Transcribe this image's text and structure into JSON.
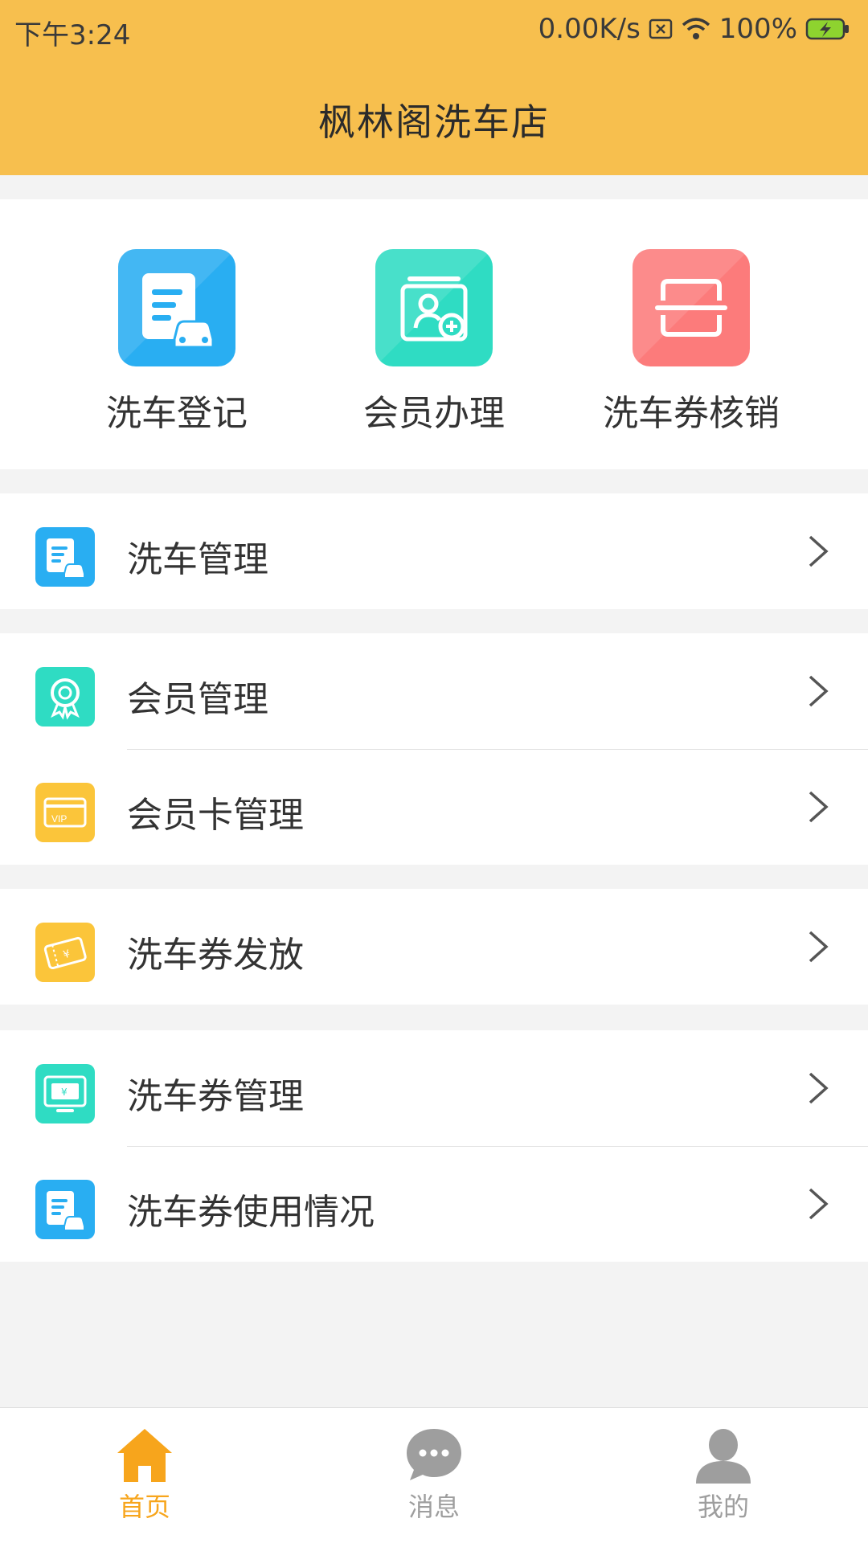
{
  "status_bar": {
    "time": "下午3:24",
    "network_speed": "0.00K/s",
    "battery": "100%",
    "icons": [
      "sim-off-icon",
      "wifi-icon",
      "battery-charging-icon"
    ]
  },
  "header": {
    "title": "枫林阁洗车店"
  },
  "quick_actions": [
    {
      "label": "洗车登记",
      "icon": "wash-register-icon",
      "color": "#29aef2"
    },
    {
      "label": "会员办理",
      "icon": "member-add-icon",
      "color": "#2fdcc3"
    },
    {
      "label": "洗车券核销",
      "icon": "scan-icon",
      "color": "#fc7b7b"
    }
  ],
  "menu": {
    "wash_management": "洗车管理",
    "member_management": "会员管理",
    "member_card_management": "会员卡管理",
    "coupon_issue": "洗车券发放",
    "coupon_management": "洗车券管理",
    "coupon_usage": "洗车券使用情况"
  },
  "tabbar": {
    "home": "首页",
    "messages": "消息",
    "mine": "我的",
    "active_color": "#f7a51c",
    "inactive_color": "#9e9e9e"
  }
}
